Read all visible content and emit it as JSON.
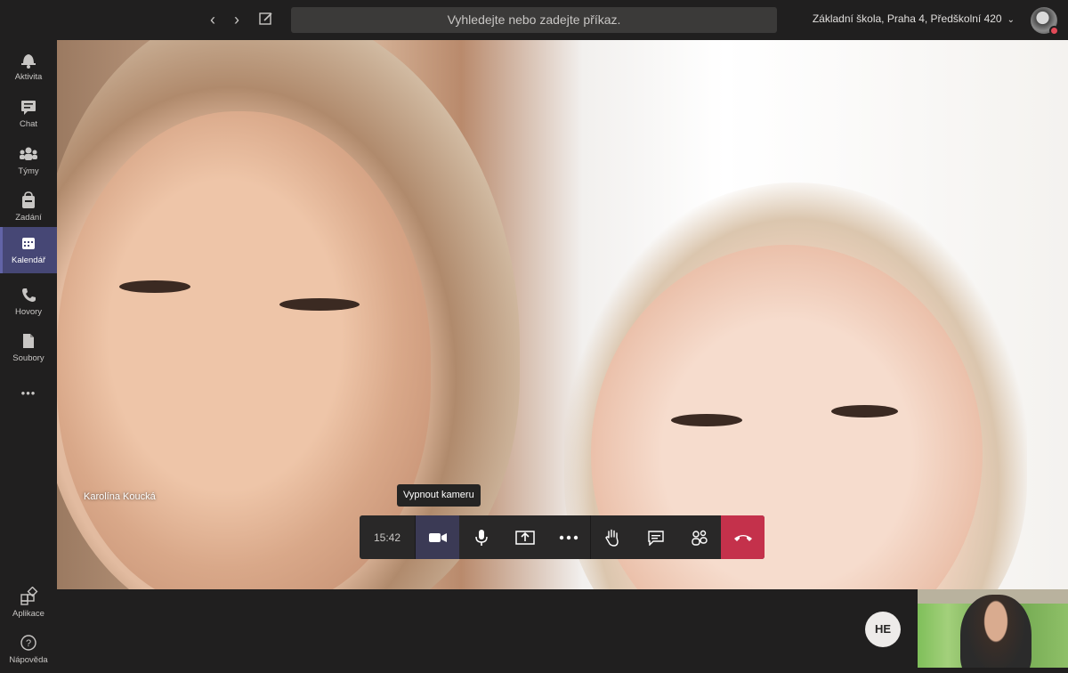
{
  "header": {
    "search_placeholder": "Vyhledejte nebo zadejte příkaz.",
    "org_name": "Základní škola, Praha 4, Předškolní 420",
    "org_chevron": "⌄"
  },
  "sidebar": {
    "items": [
      {
        "label": "Aktivita",
        "icon": "bell-icon"
      },
      {
        "label": "Chat",
        "icon": "chat-icon"
      },
      {
        "label": "Týmy",
        "icon": "teams-icon"
      },
      {
        "label": "Zadání",
        "icon": "assignments-icon"
      },
      {
        "label": "Kalendář",
        "icon": "calendar-icon",
        "active": true
      },
      {
        "label": "Hovory",
        "icon": "phone-icon"
      },
      {
        "label": "Soubory",
        "icon": "file-icon"
      }
    ],
    "more": "•••",
    "bottom_items": [
      {
        "label": "Aplikace",
        "icon": "apps-icon"
      },
      {
        "label": "Nápověda",
        "icon": "help-icon"
      }
    ]
  },
  "call": {
    "participant_name": "Karolína Koucká",
    "tooltip": "Vypnout kameru",
    "timer": "15:42",
    "controls": [
      "camera",
      "microphone",
      "share",
      "more",
      "raise-hand",
      "conversation",
      "participants",
      "hang-up"
    ],
    "participant_initials": "HE"
  },
  "colors": {
    "accent": "#6264a7",
    "rail_active": "#464775",
    "hangup": "#c4314b",
    "presence": "#e34a58"
  }
}
